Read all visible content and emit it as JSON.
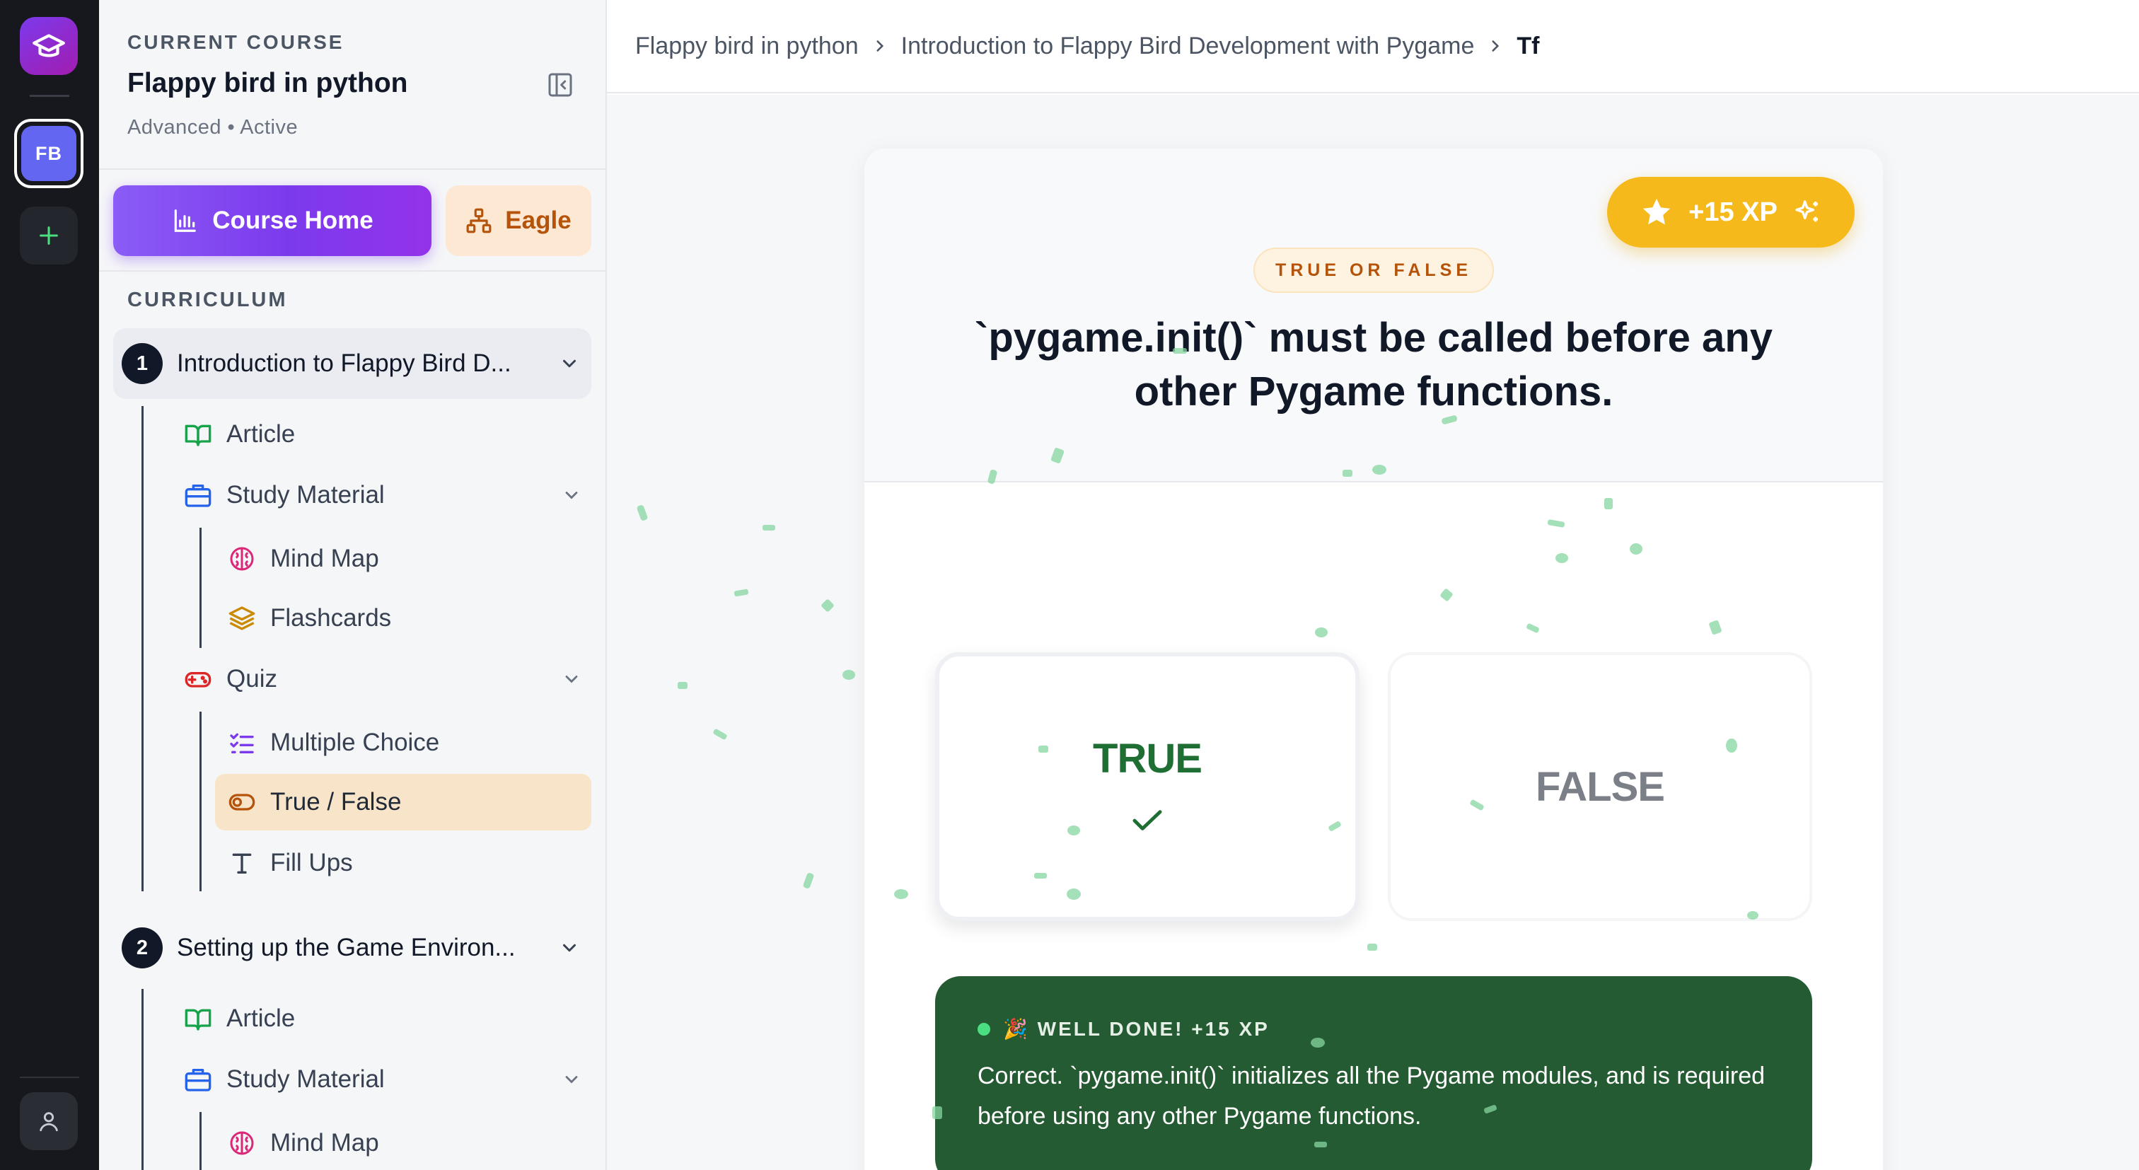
{
  "rail": {
    "logo_icon": "graduation-cap-icon",
    "active_course_initials": "FB",
    "add_icon": "plus-icon",
    "user_icon": "user-icon"
  },
  "sidebar": {
    "eyebrow": "CURRENT COURSE",
    "course_title": "Flappy bird in python",
    "course_meta": "Advanced • Active",
    "course_home_label": "Course Home",
    "eagle_label": "Eagle",
    "curriculum_label": "CURRICULUM",
    "modules": [
      {
        "number": "1",
        "title": "Introduction to Flappy Bird D...",
        "article": "Article",
        "study_material": "Study Material",
        "mind_map": "Mind Map",
        "flashcards": "Flashcards",
        "quiz": "Quiz",
        "multiple_choice": "Multiple Choice",
        "true_false": "True / False",
        "fill_ups": "Fill Ups"
      },
      {
        "number": "2",
        "title": "Setting up the Game Environ...",
        "article": "Article",
        "study_material": "Study Material",
        "mind_map": "Mind Map"
      }
    ]
  },
  "breadcrumb": {
    "items": [
      "Flappy bird in python",
      "Introduction to Flappy Bird Development with Pygame",
      "Tf"
    ]
  },
  "quiz": {
    "xp_badge": "+15 XP",
    "type_label": "TRUE OR FALSE",
    "question": "`pygame.init()` must be called before any other Pygame functions.",
    "options": [
      "TRUE",
      "FALSE"
    ],
    "selected": "TRUE",
    "feedback_title": "🎉 WELL DONE! +15 XP",
    "feedback_text": "Correct. `pygame.init()` initializes all the Pygame modules, and is required before using any other Pygame functions."
  },
  "colors": {
    "accent": "#7c3aed",
    "xp": "#f6b91c",
    "success": "#255b32",
    "active_item": "#f8e5c9"
  }
}
